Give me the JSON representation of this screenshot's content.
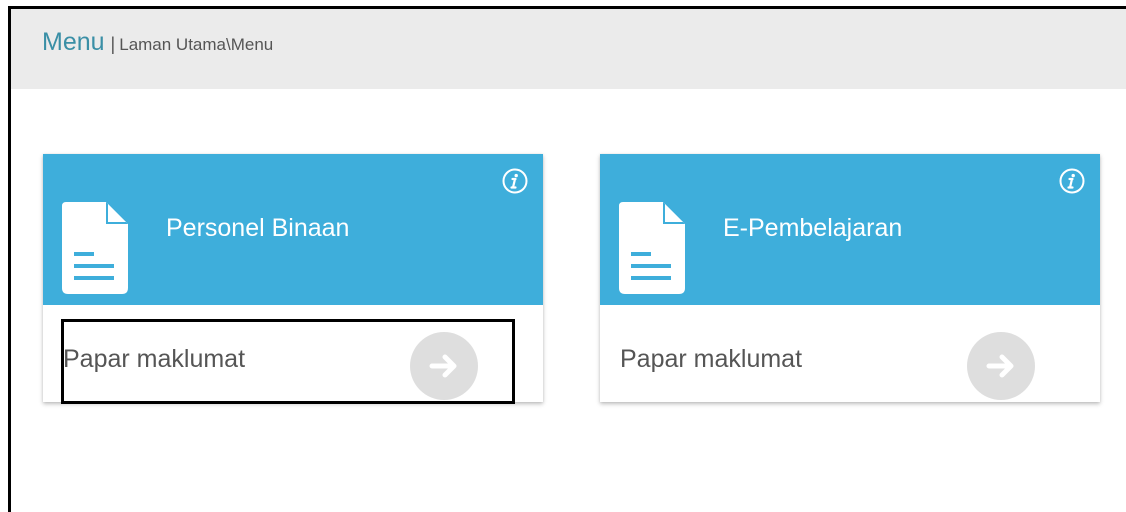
{
  "header": {
    "title": "Menu",
    "separator": "|",
    "breadcrumb": "Laman Utama\\Menu",
    "title_color": "#3a8fa6",
    "background": "#ebebeb"
  },
  "cards": [
    {
      "title": "Personel Binaan",
      "link_label": "Papar maklumat",
      "doc_icon": "document-icon",
      "info_icon": "info-icon",
      "arrow_icon": "arrow-right-circle-icon"
    },
    {
      "title": "E-Pembelajaran",
      "link_label": "Papar maklumat",
      "doc_icon": "document-icon",
      "info_icon": "info-icon",
      "arrow_icon": "arrow-right-circle-icon"
    }
  ],
  "colors": {
    "card_accent": "#3eaedb",
    "arrow_circle": "#dedede",
    "highlight_border": "#000000"
  }
}
